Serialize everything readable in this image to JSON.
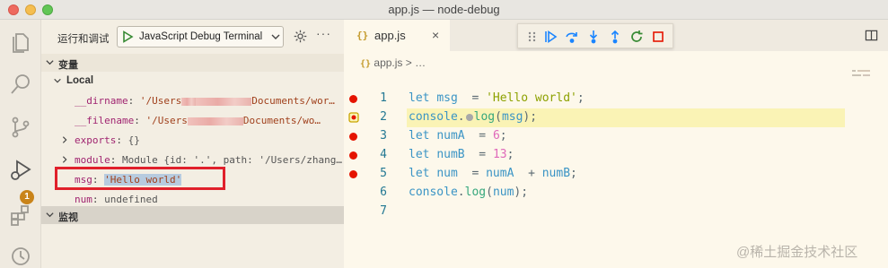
{
  "window": {
    "title": "app.js — node-debug"
  },
  "activity_bar": {
    "badge_count": "1"
  },
  "run_panel": {
    "title": "运行和调试",
    "config_label": "JavaScript Debug Terminal",
    "more": "···"
  },
  "variables": {
    "header": "变量",
    "local_label": "Local",
    "items": [
      {
        "name": "__dirname",
        "sep": ": ",
        "value_pre": "'/Users",
        "value_post": "Documents/wor…"
      },
      {
        "name": "__filename",
        "sep": ": ",
        "value_pre": "'/Users",
        "value_post": "Documents/wo…"
      },
      {
        "name": "exports",
        "sep": ": ",
        "value": "{}"
      },
      {
        "name": "module",
        "sep": ": ",
        "value": "Module {id: '.', path: '/Users/zhang…"
      },
      {
        "name": "msg",
        "sep": ": ",
        "value": "'Hello world'"
      },
      {
        "name": "num",
        "sep": ": ",
        "value": "undefined"
      }
    ]
  },
  "watch": {
    "header": "监视"
  },
  "editor": {
    "tab_icon": "{}",
    "tab_label": "app.js",
    "tab_close": "×",
    "breadcrumb_icon": "{}",
    "breadcrumb": "app.js > …",
    "lines": [
      {
        "n": "1",
        "t": [
          [
            "kw",
            "let "
          ],
          [
            "var",
            "msg"
          ],
          [
            "",
            "  = "
          ],
          [
            "str",
            "'Hello world'"
          ],
          [
            "",
            ";"
          ]
        ]
      },
      {
        "n": "2",
        "t": [
          [
            "var",
            "console"
          ],
          [
            "",
            "."
          ],
          [
            "dot",
            ""
          ],
          [
            "fn",
            "log"
          ],
          [
            "",
            "("
          ],
          [
            "var",
            "msg"
          ],
          [
            "",
            ");"
          ]
        ]
      },
      {
        "n": "3",
        "t": [
          [
            "kw",
            "let "
          ],
          [
            "var",
            "numA"
          ],
          [
            "",
            "  = "
          ],
          [
            "num",
            "6"
          ],
          [
            "",
            ";"
          ]
        ]
      },
      {
        "n": "4",
        "t": [
          [
            "kw",
            "let "
          ],
          [
            "var",
            "numB"
          ],
          [
            "",
            "  = "
          ],
          [
            "num",
            "13"
          ],
          [
            "",
            ";"
          ]
        ]
      },
      {
        "n": "5",
        "t": [
          [
            "kw",
            "let "
          ],
          [
            "var",
            "num"
          ],
          [
            "",
            "  = "
          ],
          [
            "var",
            "numA"
          ],
          [
            "",
            "  + "
          ],
          [
            "var",
            "numB"
          ],
          [
            "",
            ";"
          ]
        ]
      },
      {
        "n": "6",
        "t": [
          [
            "var",
            "console"
          ],
          [
            "",
            "."
          ],
          [
            "fn",
            "log"
          ],
          [
            "",
            "("
          ],
          [
            "var",
            "num"
          ],
          [
            "",
            ");"
          ]
        ]
      },
      {
        "n": "7",
        "t": []
      }
    ]
  },
  "watermark": "@稀土掘金技术社区",
  "colors": {
    "breakpoint": "#e51400",
    "current_line": "#faf3b5",
    "highlight_box": "#e0202b",
    "debug_continue": "#1a85ff",
    "debug_restart": "#388a34",
    "debug_stop": "#e51400"
  }
}
